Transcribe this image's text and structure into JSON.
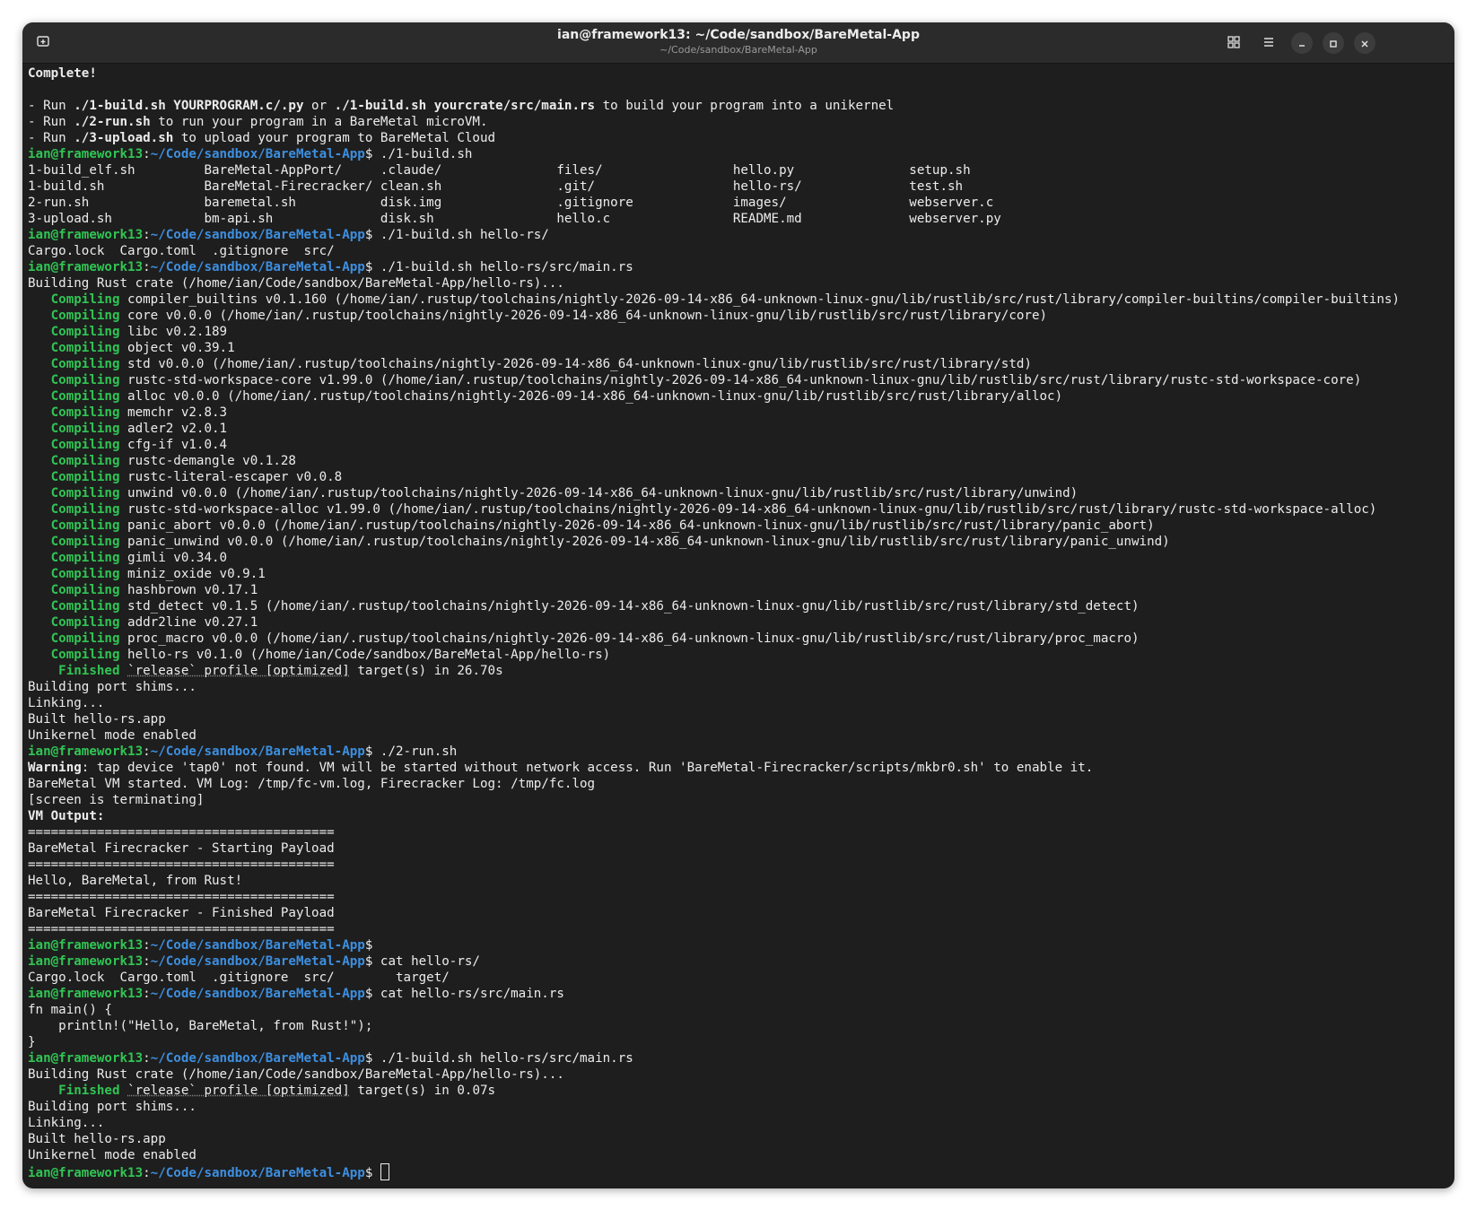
{
  "window": {
    "title": "ian@framework13: ~/Code/sandbox/BareMetal-App",
    "subtitle": "~/Code/sandbox/BareMetal-App"
  },
  "prompt": {
    "user": "ian@framework13",
    "path": "~/Code/sandbox/BareMetal-App"
  },
  "colors": {
    "green": "#31c454",
    "blue": "#3d8fe0",
    "background": "#1e1e1e"
  },
  "icons": [
    "new-tab-icon",
    "grid-view-icon",
    "hamburger-menu-icon",
    "minimize-icon",
    "maximize-icon",
    "close-icon"
  ],
  "lines": [
    [
      {
        "t": "Complete!",
        "c": "b"
      }
    ],
    [],
    [
      {
        "t": "- Run "
      },
      {
        "t": "./1-build.sh YOURPROGRAM.c/.py",
        "c": "b"
      },
      {
        "t": " or "
      },
      {
        "t": "./1-build.sh yourcrate/src/main.rs",
        "c": "b"
      },
      {
        "t": " to build your program into a unikernel"
      }
    ],
    [
      {
        "t": "- Run "
      },
      {
        "t": "./2-run.sh",
        "c": "b"
      },
      {
        "t": " to run your program in a BareMetal microVM."
      }
    ],
    [
      {
        "t": "- Run "
      },
      {
        "t": "./3-upload.sh",
        "c": "b"
      },
      {
        "t": " to upload your program to BareMetal Cloud"
      }
    ],
    [
      {
        "p": 1
      },
      {
        "t": " ./1-build.sh"
      }
    ],
    [
      {
        "t": "1-build_elf.sh         BareMetal-AppPort/     .claude/               files/                 hello.py               setup.sh"
      }
    ],
    [
      {
        "t": "1-build.sh             BareMetal-Firecracker/ clean.sh               .git/                  hello-rs/              test.sh"
      }
    ],
    [
      {
        "t": "2-run.sh               baremetal.sh           disk.img               .gitignore             images/                webserver.c"
      }
    ],
    [
      {
        "t": "3-upload.sh            bm-api.sh              disk.sh                hello.c                README.md              webserver.py"
      }
    ],
    [
      {
        "p": 1
      },
      {
        "t": " ./1-build.sh hello-rs/"
      }
    ],
    [
      {
        "t": "Cargo.lock  Cargo.toml  .gitignore  src/"
      }
    ],
    [
      {
        "p": 1
      },
      {
        "t": " ./1-build.sh hello-rs/src/main.rs"
      }
    ],
    [
      {
        "t": "Building Rust crate (/home/ian/Code/sandbox/BareMetal-App/hello-rs)..."
      }
    ],
    [
      {
        "t": "   "
      },
      {
        "t": "Compiling",
        "c": "g"
      },
      {
        "t": " compiler_builtins v0.1.160 (/home/ian/.rustup/toolchains/nightly-2026-09-14-x86_64-unknown-linux-gnu/lib/rustlib/src/rust/library/compiler-builtins/compiler-builtins)"
      }
    ],
    [
      {
        "t": "   "
      },
      {
        "t": "Compiling",
        "c": "g"
      },
      {
        "t": " core v0.0.0 (/home/ian/.rustup/toolchains/nightly-2026-09-14-x86_64-unknown-linux-gnu/lib/rustlib/src/rust/library/core)"
      }
    ],
    [
      {
        "t": "   "
      },
      {
        "t": "Compiling",
        "c": "g"
      },
      {
        "t": " libc v0.2.189"
      }
    ],
    [
      {
        "t": "   "
      },
      {
        "t": "Compiling",
        "c": "g"
      },
      {
        "t": " object v0.39.1"
      }
    ],
    [
      {
        "t": "   "
      },
      {
        "t": "Compiling",
        "c": "g"
      },
      {
        "t": " std v0.0.0 (/home/ian/.rustup/toolchains/nightly-2026-09-14-x86_64-unknown-linux-gnu/lib/rustlib/src/rust/library/std)"
      }
    ],
    [
      {
        "t": "   "
      },
      {
        "t": "Compiling",
        "c": "g"
      },
      {
        "t": " rustc-std-workspace-core v1.99.0 (/home/ian/.rustup/toolchains/nightly-2026-09-14-x86_64-unknown-linux-gnu/lib/rustlib/src/rust/library/rustc-std-workspace-core)"
      }
    ],
    [
      {
        "t": "   "
      },
      {
        "t": "Compiling",
        "c": "g"
      },
      {
        "t": " alloc v0.0.0 (/home/ian/.rustup/toolchains/nightly-2026-09-14-x86_64-unknown-linux-gnu/lib/rustlib/src/rust/library/alloc)"
      }
    ],
    [
      {
        "t": "   "
      },
      {
        "t": "Compiling",
        "c": "g"
      },
      {
        "t": " memchr v2.8.3"
      }
    ],
    [
      {
        "t": "   "
      },
      {
        "t": "Compiling",
        "c": "g"
      },
      {
        "t": " adler2 v2.0.1"
      }
    ],
    [
      {
        "t": "   "
      },
      {
        "t": "Compiling",
        "c": "g"
      },
      {
        "t": " cfg-if v1.0.4"
      }
    ],
    [
      {
        "t": "   "
      },
      {
        "t": "Compiling",
        "c": "g"
      },
      {
        "t": " rustc-demangle v0.1.28"
      }
    ],
    [
      {
        "t": "   "
      },
      {
        "t": "Compiling",
        "c": "g"
      },
      {
        "t": " rustc-literal-escaper v0.0.8"
      }
    ],
    [
      {
        "t": "   "
      },
      {
        "t": "Compiling",
        "c": "g"
      },
      {
        "t": " unwind v0.0.0 (/home/ian/.rustup/toolchains/nightly-2026-09-14-x86_64-unknown-linux-gnu/lib/rustlib/src/rust/library/unwind)"
      }
    ],
    [
      {
        "t": "   "
      },
      {
        "t": "Compiling",
        "c": "g"
      },
      {
        "t": " rustc-std-workspace-alloc v1.99.0 (/home/ian/.rustup/toolchains/nightly-2026-09-14-x86_64-unknown-linux-gnu/lib/rustlib/src/rust/library/rustc-std-workspace-alloc)"
      }
    ],
    [
      {
        "t": "   "
      },
      {
        "t": "Compiling",
        "c": "g"
      },
      {
        "t": " panic_abort v0.0.0 (/home/ian/.rustup/toolchains/nightly-2026-09-14-x86_64-unknown-linux-gnu/lib/rustlib/src/rust/library/panic_abort)"
      }
    ],
    [
      {
        "t": "   "
      },
      {
        "t": "Compiling",
        "c": "g"
      },
      {
        "t": " panic_unwind v0.0.0 (/home/ian/.rustup/toolchains/nightly-2026-09-14-x86_64-unknown-linux-gnu/lib/rustlib/src/rust/library/panic_unwind)"
      }
    ],
    [
      {
        "t": "   "
      },
      {
        "t": "Compiling",
        "c": "g"
      },
      {
        "t": " gimli v0.34.0"
      }
    ],
    [
      {
        "t": "   "
      },
      {
        "t": "Compiling",
        "c": "g"
      },
      {
        "t": " miniz_oxide v0.9.1"
      }
    ],
    [
      {
        "t": "   "
      },
      {
        "t": "Compiling",
        "c": "g"
      },
      {
        "t": " hashbrown v0.17.1"
      }
    ],
    [
      {
        "t": "   "
      },
      {
        "t": "Compiling",
        "c": "g"
      },
      {
        "t": " std_detect v0.1.5 (/home/ian/.rustup/toolchains/nightly-2026-09-14-x86_64-unknown-linux-gnu/lib/rustlib/src/rust/library/std_detect)"
      }
    ],
    [
      {
        "t": "   "
      },
      {
        "t": "Compiling",
        "c": "g"
      },
      {
        "t": " addr2line v0.27.1"
      }
    ],
    [
      {
        "t": "   "
      },
      {
        "t": "Compiling",
        "c": "g"
      },
      {
        "t": " proc_macro v0.0.0 (/home/ian/.rustup/toolchains/nightly-2026-09-14-x86_64-unknown-linux-gnu/lib/rustlib/src/rust/library/proc_macro)"
      }
    ],
    [
      {
        "t": "   "
      },
      {
        "t": "Compiling",
        "c": "g"
      },
      {
        "t": " hello-rs v0.1.0 (/home/ian/Code/sandbox/BareMetal-App/hello-rs)"
      }
    ],
    [
      {
        "t": "    "
      },
      {
        "t": "Finished",
        "c": "g"
      },
      {
        "t": " "
      },
      {
        "t": "`release` profile [optimized]",
        "c": "dim"
      },
      {
        "t": " target(s) in 26.70s"
      }
    ],
    [
      {
        "t": "Building port shims..."
      }
    ],
    [
      {
        "t": "Linking..."
      }
    ],
    [
      {
        "t": "Built hello-rs.app"
      }
    ],
    [
      {
        "t": "Unikernel mode enabled"
      }
    ],
    [
      {
        "p": 1
      },
      {
        "t": " ./2-run.sh"
      }
    ],
    [
      {
        "t": "Warning",
        "c": "b"
      },
      {
        "t": ": tap device 'tap0' not found. VM will be started without network access. Run 'BareMetal-Firecracker/scripts/mkbr0.sh' to enable it."
      }
    ],
    [
      {
        "t": "BareMetal VM started. VM Log: /tmp/fc-vm.log, Firecracker Log: /tmp/fc.log"
      }
    ],
    [
      {
        "t": "[screen is terminating]"
      }
    ],
    [
      {
        "t": "VM Output:",
        "c": "b"
      }
    ],
    [
      {
        "t": "========================================"
      }
    ],
    [
      {
        "t": "BareMetal Firecracker - Starting Payload"
      }
    ],
    [
      {
        "t": "========================================"
      }
    ],
    [
      {
        "t": "Hello, BareMetal, from Rust!"
      }
    ],
    [
      {
        "t": "========================================"
      }
    ],
    [
      {
        "t": "BareMetal Firecracker - Finished Payload"
      }
    ],
    [
      {
        "t": "========================================"
      }
    ],
    [
      {
        "p": 1
      }
    ],
    [
      {
        "p": 1
      },
      {
        "t": " cat hello-rs/"
      }
    ],
    [
      {
        "t": "Cargo.lock  Cargo.toml  .gitignore  src/        target/"
      }
    ],
    [
      {
        "p": 1
      },
      {
        "t": " cat hello-rs/src/main.rs"
      }
    ],
    [
      {
        "t": "fn main() {"
      }
    ],
    [
      {
        "t": "    println!(\"Hello, BareMetal, from Rust!\");"
      }
    ],
    [
      {
        "t": "}"
      }
    ],
    [
      {
        "p": 1
      },
      {
        "t": " ./1-build.sh hello-rs/src/main.rs"
      }
    ],
    [
      {
        "t": "Building Rust crate (/home/ian/Code/sandbox/BareMetal-App/hello-rs)..."
      }
    ],
    [
      {
        "t": "    "
      },
      {
        "t": "Finished",
        "c": "g"
      },
      {
        "t": " "
      },
      {
        "t": "`release` profile [optimized]",
        "c": "dim"
      },
      {
        "t": " target(s) in 0.07s"
      }
    ],
    [
      {
        "t": "Building port shims..."
      }
    ],
    [
      {
        "t": "Linking..."
      }
    ],
    [
      {
        "t": "Built hello-rs.app"
      }
    ],
    [
      {
        "t": "Unikernel mode enabled"
      }
    ],
    [
      {
        "p": 1
      },
      {
        "t": " "
      },
      {
        "cursor": 1
      }
    ]
  ]
}
